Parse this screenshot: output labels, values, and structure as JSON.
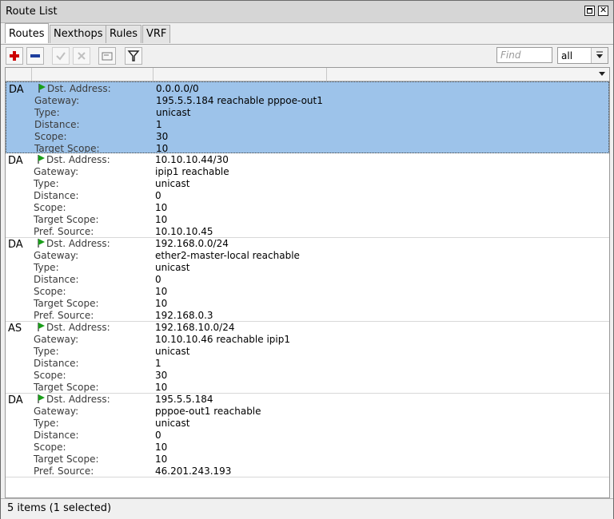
{
  "window": {
    "title": "Route List"
  },
  "tabs": [
    "Routes",
    "Nexthops",
    "Rules",
    "VRF"
  ],
  "search": {
    "placeholder": "Find",
    "filter_value": "all"
  },
  "field_labels": {
    "dst": "Dst. Address:",
    "gateway": "Gateway:",
    "type": "Type:",
    "distance": "Distance:",
    "scope": "Scope:",
    "target_scope": "Target Scope:",
    "pref_source": "Pref. Source:"
  },
  "routes": [
    {
      "flags": "DA",
      "dst": "0.0.0.0/0",
      "gateway": "195.5.5.184 reachable pppoe-out1",
      "type": "unicast",
      "distance": "1",
      "scope": "30",
      "target_scope": "10",
      "selected": true
    },
    {
      "flags": "DA",
      "dst": "10.10.10.44/30",
      "gateway": "ipip1 reachable",
      "type": "unicast",
      "distance": "0",
      "scope": "10",
      "target_scope": "10",
      "pref_source": "10.10.10.45"
    },
    {
      "flags": "DA",
      "dst": "192.168.0.0/24",
      "gateway": "ether2-master-local reachable",
      "type": "unicast",
      "distance": "0",
      "scope": "10",
      "target_scope": "10",
      "pref_source": "192.168.0.3"
    },
    {
      "flags": "AS",
      "dst": "192.168.10.0/24",
      "gateway": "10.10.10.46 reachable ipip1",
      "type": "unicast",
      "distance": "1",
      "scope": "30",
      "target_scope": "10"
    },
    {
      "flags": "DA",
      "dst": "195.5.5.184",
      "gateway": "pppoe-out1 reachable",
      "type": "unicast",
      "distance": "0",
      "scope": "10",
      "target_scope": "10",
      "pref_source": "46.201.243.193"
    }
  ],
  "status": {
    "text": "5 items (1 selected)"
  },
  "colors": {
    "selected_row": "#9dc3ea",
    "add": "#cc0000",
    "remove": "#1e3f9e",
    "flag": "#1a9e1a"
  }
}
